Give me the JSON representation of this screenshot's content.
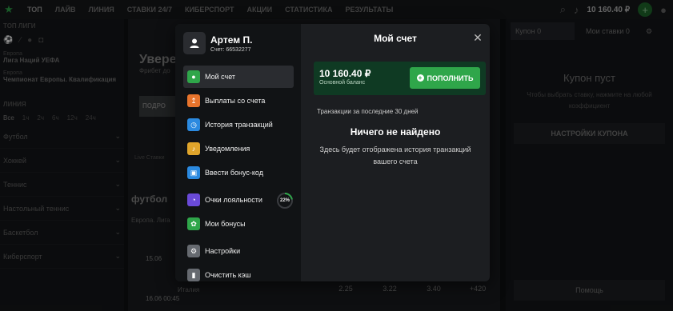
{
  "topbar": {
    "nav": [
      "ТОП",
      "ЛАЙВ",
      "ЛИНИЯ",
      "СТАВКИ 24/7",
      "КИБЕРСПОРТ",
      "АКЦИИ",
      "СТАТИСТИКА",
      "РЕЗУЛЬТАТЫ"
    ],
    "balance": "10 160.40 ₽"
  },
  "left": {
    "top_leagues": "ТОП ЛИГИ",
    "leagues": [
      {
        "sub": "Европа",
        "title": "Лига Наций УЕФА"
      },
      {
        "sub": "Европа",
        "title": "Чемпионат Европы. Квалификация"
      }
    ],
    "line": "ЛИНИЯ",
    "periods": [
      "Все",
      "1ч",
      "2ч",
      "6ч",
      "12ч",
      "24ч"
    ],
    "sports": [
      "Футбол",
      "Хоккей",
      "Теннис",
      "Настольный теннис",
      "Баскетбол",
      "Киберспорт"
    ]
  },
  "main": {
    "banner_title": "Увере",
    "banner_sub": "Фрибет до",
    "banner_button": "ПОДРО",
    "live_label": "Live Ставки",
    "section": "футбол",
    "league": "Европа. Лига",
    "rows": [
      {
        "date": "15.06",
        "team": ""
      },
      {
        "date": "16.06 00:45",
        "team": "Италия",
        "odds": [
          "2.25",
          "3.22",
          "3.40",
          "+420"
        ]
      }
    ]
  },
  "coupon": {
    "tab_coupon": "Купон",
    "tab_coupon_count": "0",
    "tab_bets": "Мои ставки",
    "tab_bets_count": "0",
    "empty_title": "Купон пуст",
    "empty_hint": "Чтобы выбрать ставку, нажмите на любой коэффициент",
    "settings": "НАСТРОЙКИ КУПОНА",
    "help": "Помощь"
  },
  "modal": {
    "user_name": "Артем П.",
    "account": "Счет: 66532277",
    "title": "Мой счет",
    "balance": "10 160.40 ₽",
    "balance_label": "Основной баланс",
    "topup": "ПОПОЛНИТЬ",
    "period": "Транзакции за последние 30 дней",
    "empty_title": "Ничего не найдено",
    "empty_desc": "Здесь будет отображена история транзакций вашего счета",
    "loyalty_percent": "22%",
    "loyalty_fraction": 0.22,
    "menu": [
      {
        "label": "Мой счет",
        "icon": "account-icon",
        "color": "#2fa64a"
      },
      {
        "label": "Выплаты со счета",
        "icon": "upload-icon",
        "color": "#e8742c"
      },
      {
        "label": "История транзакций",
        "icon": "clock-icon",
        "color": "#2b8ae0"
      },
      {
        "label": "Уведомления",
        "icon": "bell-icon",
        "color": "#e0a52b"
      },
      {
        "label": "Ввести бонус-код",
        "icon": "ticket-icon",
        "color": "#2b8ae0"
      },
      {
        "label": "Очки лояльности",
        "icon": "loyalty-icon",
        "color": "#6a4ad8"
      },
      {
        "label": "Мои бонусы",
        "icon": "gift-icon",
        "color": "#2fa64a"
      },
      {
        "label": "Настройки",
        "icon": "gear-icon",
        "color": "#666a70"
      },
      {
        "label": "Очистить кэш",
        "icon": "trash-icon",
        "color": "#666a70"
      }
    ]
  }
}
